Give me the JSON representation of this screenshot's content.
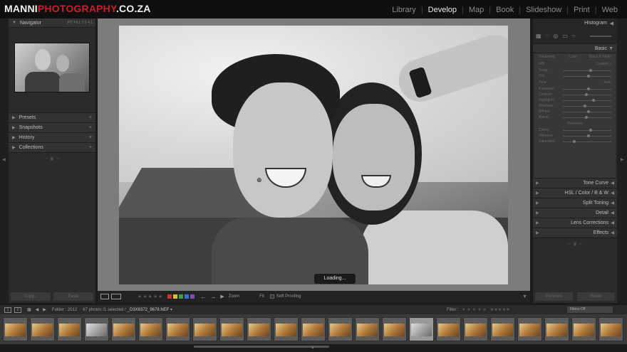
{
  "logo": {
    "white_part": "MANNI",
    "red_part": "PHOTOGRAPHY",
    "suffix": ".CO.ZA"
  },
  "modules": [
    {
      "label": "Library",
      "active": false
    },
    {
      "label": "Develop",
      "active": true
    },
    {
      "label": "Map",
      "active": false
    },
    {
      "label": "Book",
      "active": false
    },
    {
      "label": "Slideshow",
      "active": false
    },
    {
      "label": "Print",
      "active": false
    },
    {
      "label": "Web",
      "active": false
    }
  ],
  "left_panel": {
    "navigator_title": "Navigator",
    "navigator_options": "FIT  FILL  1:1  4:1",
    "sections": [
      {
        "label": "Presets",
        "action": "+"
      },
      {
        "label": "Snapshots",
        "action": "+"
      },
      {
        "label": "History",
        "action": "×"
      },
      {
        "label": "Collections",
        "action": "+"
      }
    ],
    "copy_button": "Copy...",
    "paste_button": "Paste"
  },
  "center": {
    "loading_text": "Loading..."
  },
  "toolbar": {
    "zoom_label": "Zoom",
    "zoom_value": "Fit",
    "soft_proofing": "Soft Proofing",
    "stars": "★★★★★",
    "flag_colors": [
      "#d03030",
      "#d8c030",
      "#40a040",
      "#3a6fd0",
      "#8a4ab0"
    ]
  },
  "right_panel": {
    "histogram_title": "Histogram",
    "basic_title": "Basic",
    "treatment_row": {
      "left": "Treatment :",
      "mid": "Color",
      "right": "Black & White"
    },
    "wb_row": {
      "left": "WB :",
      "right": "Custom ÷"
    },
    "basic_sliders": [
      {
        "label": "Temp",
        "knob": 0.55
      },
      {
        "label": "Tint",
        "knob": 0.5
      },
      {
        "label": "Exposure",
        "knob": 0.5
      },
      {
        "label": "Contrast",
        "knob": 0.45
      },
      {
        "label": "Highlights",
        "knob": 0.6
      },
      {
        "label": "Shadows",
        "knob": 0.42
      },
      {
        "label": "Whites",
        "knob": 0.5
      },
      {
        "label": "Blacks",
        "knob": 0.45
      },
      {
        "label": "Clarity",
        "knob": 0.55
      },
      {
        "label": "Vibrance",
        "knob": 0.5
      },
      {
        "label": "Saturation",
        "knob": 0.2
      }
    ],
    "tone_row": {
      "left": "Tone",
      "right": "Auto"
    },
    "presence_label": "Presence",
    "sections": [
      "Tone Curve",
      "HSL  /  Color  /  B & W",
      "Split Toning",
      "Detail",
      "Lens Corrections",
      "Effects"
    ],
    "previous_button": "Previous",
    "reset_button": "Reset"
  },
  "filmbar": {
    "box1": "1",
    "box2": "2",
    "folder": "Folder : 2012",
    "count": "67 photos /1 selected /",
    "filename": "_D3X6372_9678.NEF",
    "filter_label": "Filter :",
    "filter_select": "Filters Off"
  },
  "filmstrip": {
    "selected_index": 15,
    "cell_count": 23
  }
}
